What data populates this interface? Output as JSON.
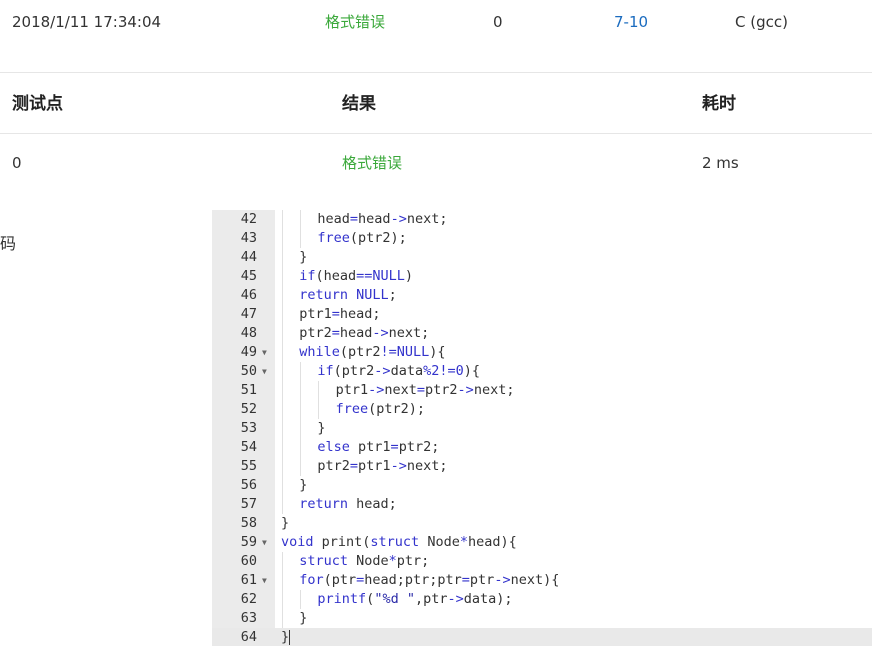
{
  "submission": {
    "time": "2018/1/11 17:34:04",
    "status": "格式错误",
    "score": "0",
    "problem": "7-10",
    "language": "C (gcc)"
  },
  "test_table": {
    "headers": {
      "case": "测试点",
      "result": "结果",
      "time": "耗时"
    },
    "rows": [
      {
        "case": "0",
        "result": "格式错误",
        "time": "2 ms"
      }
    ]
  },
  "code_section": {
    "label": "代码"
  },
  "colors": {
    "status_accent": "#3aa83a",
    "link": "#1a6bbf",
    "keyword": "#3333cc"
  },
  "code_lines": [
    {
      "n": "42",
      "fold": false,
      "indent": 2,
      "text": "head=head->next;"
    },
    {
      "n": "43",
      "fold": false,
      "indent": 2,
      "text": "free(ptr2);"
    },
    {
      "n": "44",
      "fold": false,
      "indent": 1,
      "text": "}"
    },
    {
      "n": "45",
      "fold": false,
      "indent": 1,
      "text": "if(head==NULL)"
    },
    {
      "n": "46",
      "fold": false,
      "indent": 1,
      "text": "return NULL;"
    },
    {
      "n": "47",
      "fold": false,
      "indent": 1,
      "text": "ptr1=head;"
    },
    {
      "n": "48",
      "fold": false,
      "indent": 1,
      "text": "ptr2=head->next;"
    },
    {
      "n": "49",
      "fold": true,
      "indent": 1,
      "text": "while(ptr2!=NULL){"
    },
    {
      "n": "50",
      "fold": true,
      "indent": 2,
      "text": "if(ptr2->data%2!=0){"
    },
    {
      "n": "51",
      "fold": false,
      "indent": 3,
      "text": "ptr1->next=ptr2->next;"
    },
    {
      "n": "52",
      "fold": false,
      "indent": 3,
      "text": "free(ptr2);"
    },
    {
      "n": "53",
      "fold": false,
      "indent": 2,
      "text": "}"
    },
    {
      "n": "54",
      "fold": false,
      "indent": 2,
      "text": "else ptr1=ptr2;"
    },
    {
      "n": "55",
      "fold": false,
      "indent": 2,
      "text": "ptr2=ptr1->next;"
    },
    {
      "n": "56",
      "fold": false,
      "indent": 1,
      "text": "}"
    },
    {
      "n": "57",
      "fold": false,
      "indent": 1,
      "text": "return head;"
    },
    {
      "n": "58",
      "fold": false,
      "indent": 0,
      "text": "}"
    },
    {
      "n": "59",
      "fold": true,
      "indent": 0,
      "text": "void print(struct Node*head){"
    },
    {
      "n": "60",
      "fold": false,
      "indent": 1,
      "text": "struct Node*ptr;"
    },
    {
      "n": "61",
      "fold": true,
      "indent": 1,
      "text": "for(ptr=head;ptr;ptr=ptr->next){"
    },
    {
      "n": "62",
      "fold": false,
      "indent": 2,
      "text": "printf(\"%d \",ptr->data);"
    },
    {
      "n": "63",
      "fold": false,
      "indent": 1,
      "text": "}"
    },
    {
      "n": "64",
      "fold": false,
      "indent": 0,
      "text": "}",
      "active": true
    }
  ]
}
